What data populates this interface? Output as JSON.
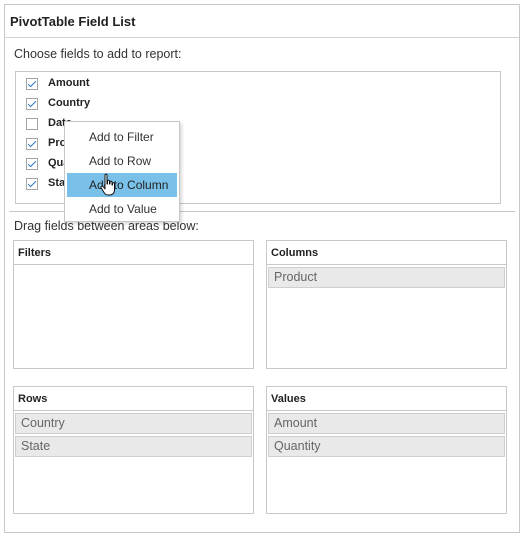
{
  "title": "PivotTable Field List",
  "choose_label": "Choose fields to add to report:",
  "fields": [
    {
      "name": "Amount",
      "checked": true
    },
    {
      "name": "Country",
      "checked": true
    },
    {
      "name": "Date",
      "checked": false
    },
    {
      "name": "Prod",
      "checked": true
    },
    {
      "name": "Qua",
      "checked": true
    },
    {
      "name": "Stat",
      "checked": true
    }
  ],
  "drag_label": "Drag fields between areas below:",
  "areas": {
    "filters": {
      "header": "Filters",
      "items": []
    },
    "columns": {
      "header": "Columns",
      "items": [
        "Product"
      ]
    },
    "rows": {
      "header": "Rows",
      "items": [
        "Country",
        "State"
      ]
    },
    "values": {
      "header": "Values",
      "items": [
        "Amount",
        "Quantity"
      ]
    }
  },
  "context_menu": {
    "items": [
      "Add to Filter",
      "Add to Row",
      "Add to Column",
      "Add to Value"
    ],
    "highlighted": "Add to Column"
  },
  "colors": {
    "highlight": "#79c1e8",
    "check": "#2b78c6",
    "chip": "#e9e9e9"
  }
}
